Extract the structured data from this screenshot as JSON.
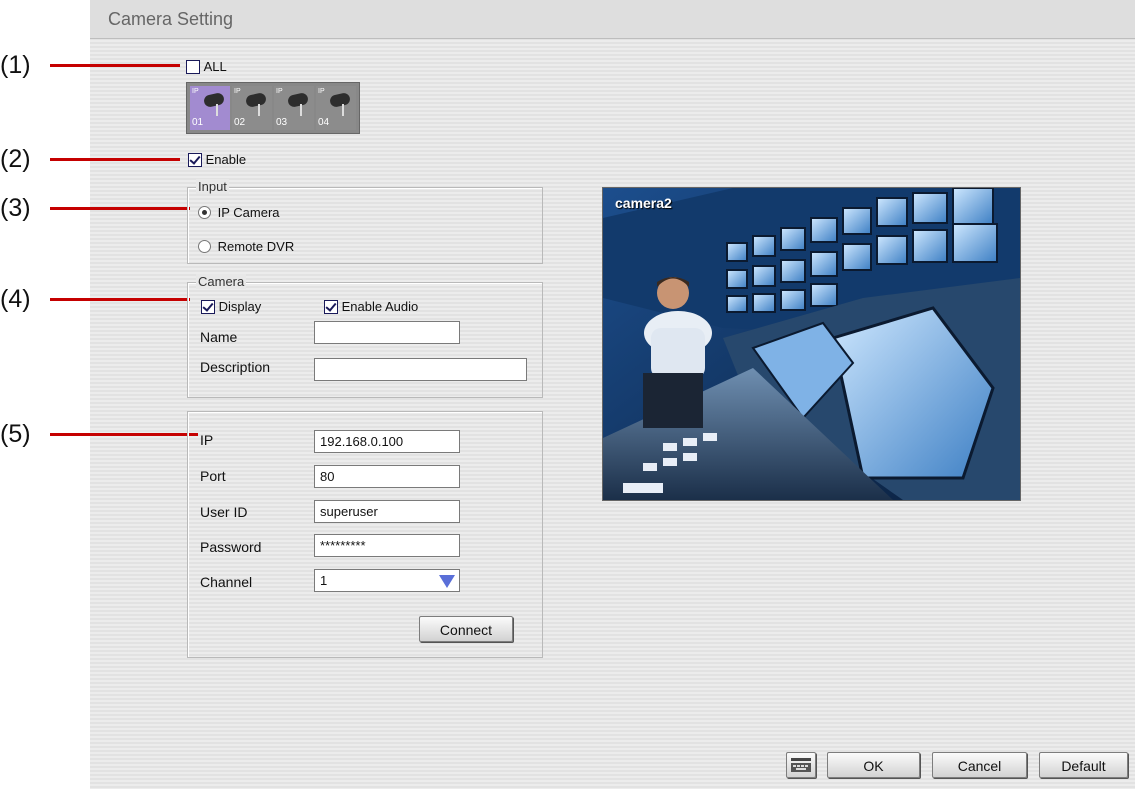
{
  "window": {
    "title": "Camera Setting"
  },
  "callouts": [
    "(1)",
    "(2)",
    "(3)",
    "(4)",
    "(5)"
  ],
  "all_checkbox": {
    "label": "ALL",
    "checked": false
  },
  "camera_tabs": [
    {
      "tag": "IP",
      "number": "01",
      "selected": true
    },
    {
      "tag": "IP",
      "number": "02",
      "selected": false
    },
    {
      "tag": "IP",
      "number": "03",
      "selected": false
    },
    {
      "tag": "IP",
      "number": "04",
      "selected": false
    }
  ],
  "enable": {
    "label": "Enable",
    "checked": true
  },
  "input_group": {
    "legend": "Input",
    "options": [
      {
        "label": "IP Camera",
        "selected": true
      },
      {
        "label": "Remote DVR",
        "selected": false
      }
    ]
  },
  "camera_group": {
    "legend": "Camera",
    "display": {
      "label": "Display",
      "checked": true
    },
    "enable_audio": {
      "label": "Enable Audio",
      "checked": true
    },
    "name_label": "Name",
    "name_value": "",
    "description_label": "Description",
    "description_value": ""
  },
  "connection": {
    "ip_label": "IP",
    "ip_value": "192.168.0.100",
    "port_label": "Port",
    "port_value": "80",
    "userid_label": "User ID",
    "userid_value": "superuser",
    "password_label": "Password",
    "password_value": "*********",
    "channel_label": "Channel",
    "channel_value": "1",
    "connect_label": "Connect"
  },
  "preview": {
    "camera_name": "camera2"
  },
  "footer": {
    "ok_label": "OK",
    "cancel_label": "Cancel",
    "default_label": "Default",
    "icon": "keyboard-icon"
  },
  "colors": {
    "callout_line": "#c50000",
    "selected_tab": "#a28bd0",
    "legend_text": "#333333"
  }
}
